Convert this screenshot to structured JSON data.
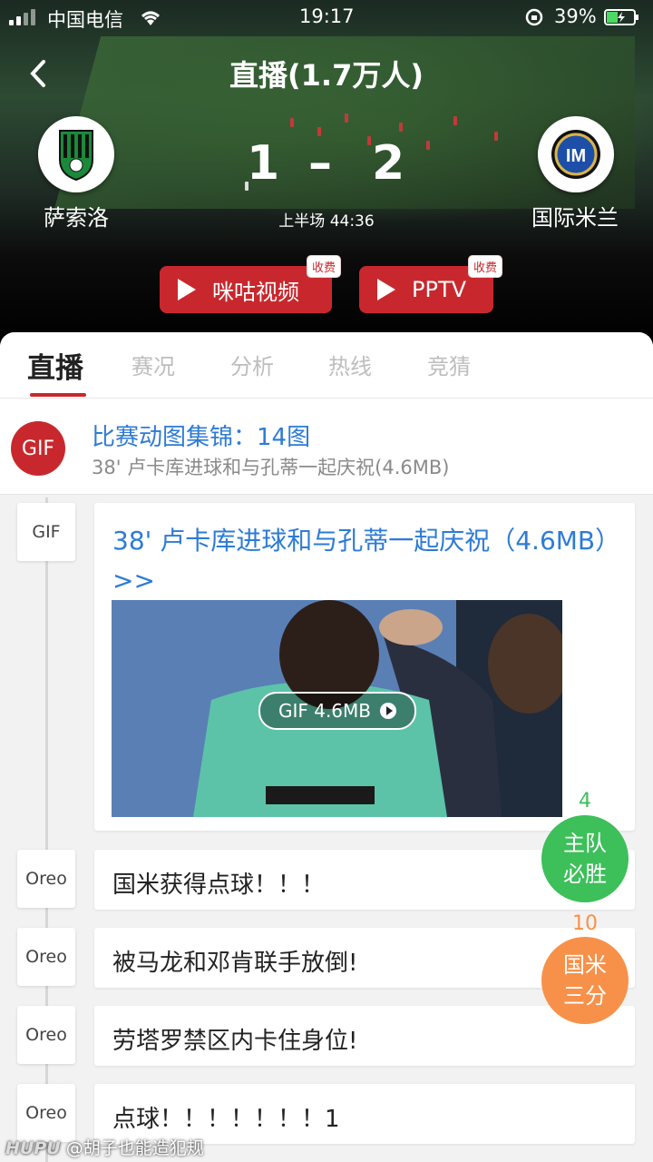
{
  "status_bar": {
    "carrier": "中国电信",
    "time": "19:17",
    "battery": "39%"
  },
  "header": {
    "title": "直播(1.7万人)"
  },
  "match": {
    "home": {
      "name": "萨索洛",
      "score": "1"
    },
    "away": {
      "name": "国际米兰",
      "score": "2"
    },
    "separator": "–",
    "period": "上半场 44:36"
  },
  "video_buttons": [
    {
      "label": "咪咕视频",
      "badge": "收费"
    },
    {
      "label": "PPTV",
      "badge": "收费"
    }
  ],
  "tabs": [
    {
      "label": "直播",
      "active": true
    },
    {
      "label": "赛况"
    },
    {
      "label": "分析"
    },
    {
      "label": "热线"
    },
    {
      "label": "竞猜"
    }
  ],
  "highlight": {
    "icon_text": "GIF",
    "title": "比赛动图集锦：14图",
    "subtitle": "38' 卢卡库进球和与孔蒂一起庆祝(4.6MB)"
  },
  "feed": [
    {
      "author": "GIF",
      "type": "gif",
      "title": "38' 卢卡库进球和与孔蒂一起庆祝（4.6MB）>>",
      "badge": "GIF 4.6MB"
    },
    {
      "author": "Oreo",
      "text": "国米获得点球！！！"
    },
    {
      "author": "Oreo",
      "text": "被马龙和邓肯联手放倒!"
    },
    {
      "author": "Oreo",
      "text": "劳塔罗禁区内卡住身位!"
    },
    {
      "author": "Oreo",
      "text": "点球！！！！！！！1"
    }
  ],
  "votes": [
    {
      "count": "4",
      "label_line1": "主队",
      "label_line2": "必胜",
      "color": "#3dbf5a"
    },
    {
      "count": "10",
      "label_line1": "国米",
      "label_line2": "三分",
      "color": "#f7914a"
    }
  ],
  "watermark": {
    "brand": "HUPU",
    "handle": "@胡子也能造犯规"
  }
}
